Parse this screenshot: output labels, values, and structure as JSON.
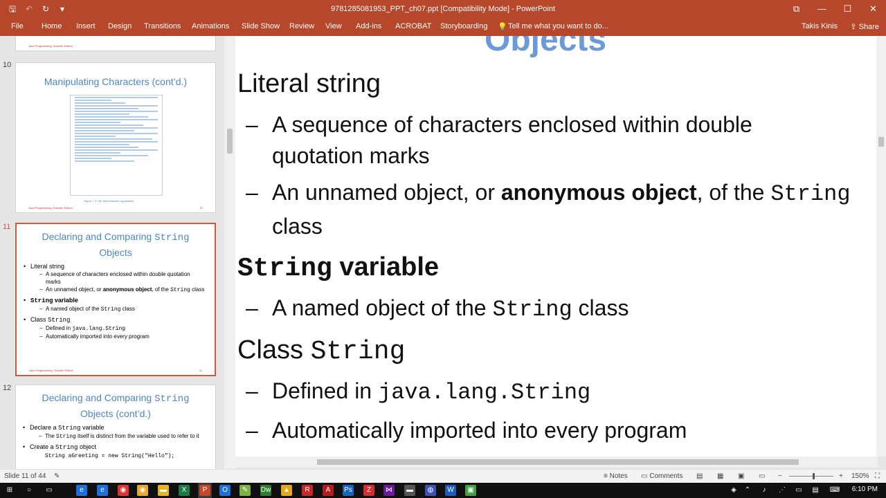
{
  "window": {
    "title": "9781285081953_PPT_ch07.ppt [Compatibility Mode] - PowerPoint",
    "controls": [
      "⧉",
      "—",
      "☐",
      "✕"
    ]
  },
  "qat": {
    "save": "🖫",
    "undo": "↶",
    "redo": "↻",
    "customize": "▾"
  },
  "ribbon": {
    "tabs": [
      "File",
      "Home",
      "Insert",
      "Design",
      "Transitions",
      "Animations",
      "Slide Show",
      "Review",
      "View",
      "Add-ins",
      "ACROBAT",
      "Storyboarding"
    ],
    "tell_me": "Tell me what you want to do...",
    "user": "Takis Kinis",
    "share": "Share"
  },
  "slides": {
    "s10": {
      "num": "10",
      "title": "Manipulating Characters (cont’d.)",
      "caption": "Figure 7-3  The TestCharacter application",
      "footer": "Java Programming, Seventh Edition",
      "page": "10"
    },
    "s11": {
      "num": "11",
      "title_pre": "Declaring and Comparing ",
      "title_mono": "String",
      "title_post": "Objects",
      "b1": "Literal string",
      "b1a": "A sequence of characters enclosed within double quotation marks",
      "b1b_pre": "An unnamed object, or ",
      "b1b_bold": "anonymous object",
      "b1b_mid": ", of the ",
      "b1b_mono": "String",
      "b1b_post": " class",
      "b2_mono": "String",
      "b2_bold": " variable",
      "b2a_pre": "A named object of the ",
      "b2a_mono": "String",
      "b2a_post": " class",
      "b3_pre": "Class ",
      "b3_mono": "String",
      "b3a_pre": "Defined in ",
      "b3a_mono": "java.lang.String",
      "b3b": "Automatically imported into every program",
      "footer": "Java Programming, Seventh Edition",
      "page": "11"
    },
    "s12": {
      "num": "12",
      "title_pre": "Declaring and Comparing ",
      "title_mono": "String",
      "title_post": "Objects (cont’d.)",
      "b1_pre": "Declare a ",
      "b1_mono": "String",
      "b1_post": " variable",
      "b1a_pre": "The ",
      "b1a_mono": "String",
      "b1a_post": " itself is distinct from the variable used to refer to it",
      "b2_pre": "Create a ",
      "b2_mono": "String",
      "b2_post": " object",
      "code": "String aGreeting = new String(\"Hello\");"
    },
    "top_footer": "Java Programming, Seventh Edition"
  },
  "main_slide": {
    "title_cut": "Objects",
    "l1": "Literal string",
    "l1a": "A sequence of characters enclosed within double",
    "l1a_cont": "quotation marks",
    "l1b_pre": "An unnamed object, or ",
    "l1b_bold": "anonymous object",
    "l1b_mid": ", of the ",
    "l1b_mono": "String",
    "l1b_cont": "class",
    "l2_mono": "String",
    "l2_bold": " variable",
    "l2a_pre": "A named object of the ",
    "l2a_mono": "String",
    "l2a_post": " class",
    "l3_pre": "Class ",
    "l3_mono": "String",
    "l3a_pre": "Defined in ",
    "l3a_mono": "java.lang.String",
    "l3b": "Automatically imported into every program",
    "dash": "–"
  },
  "status": {
    "slide_of": "Slide 11 of 44",
    "notes": "Notes",
    "comments": "Comments",
    "zoom": "150%"
  },
  "taskbar": {
    "time": "6:10 PM"
  }
}
